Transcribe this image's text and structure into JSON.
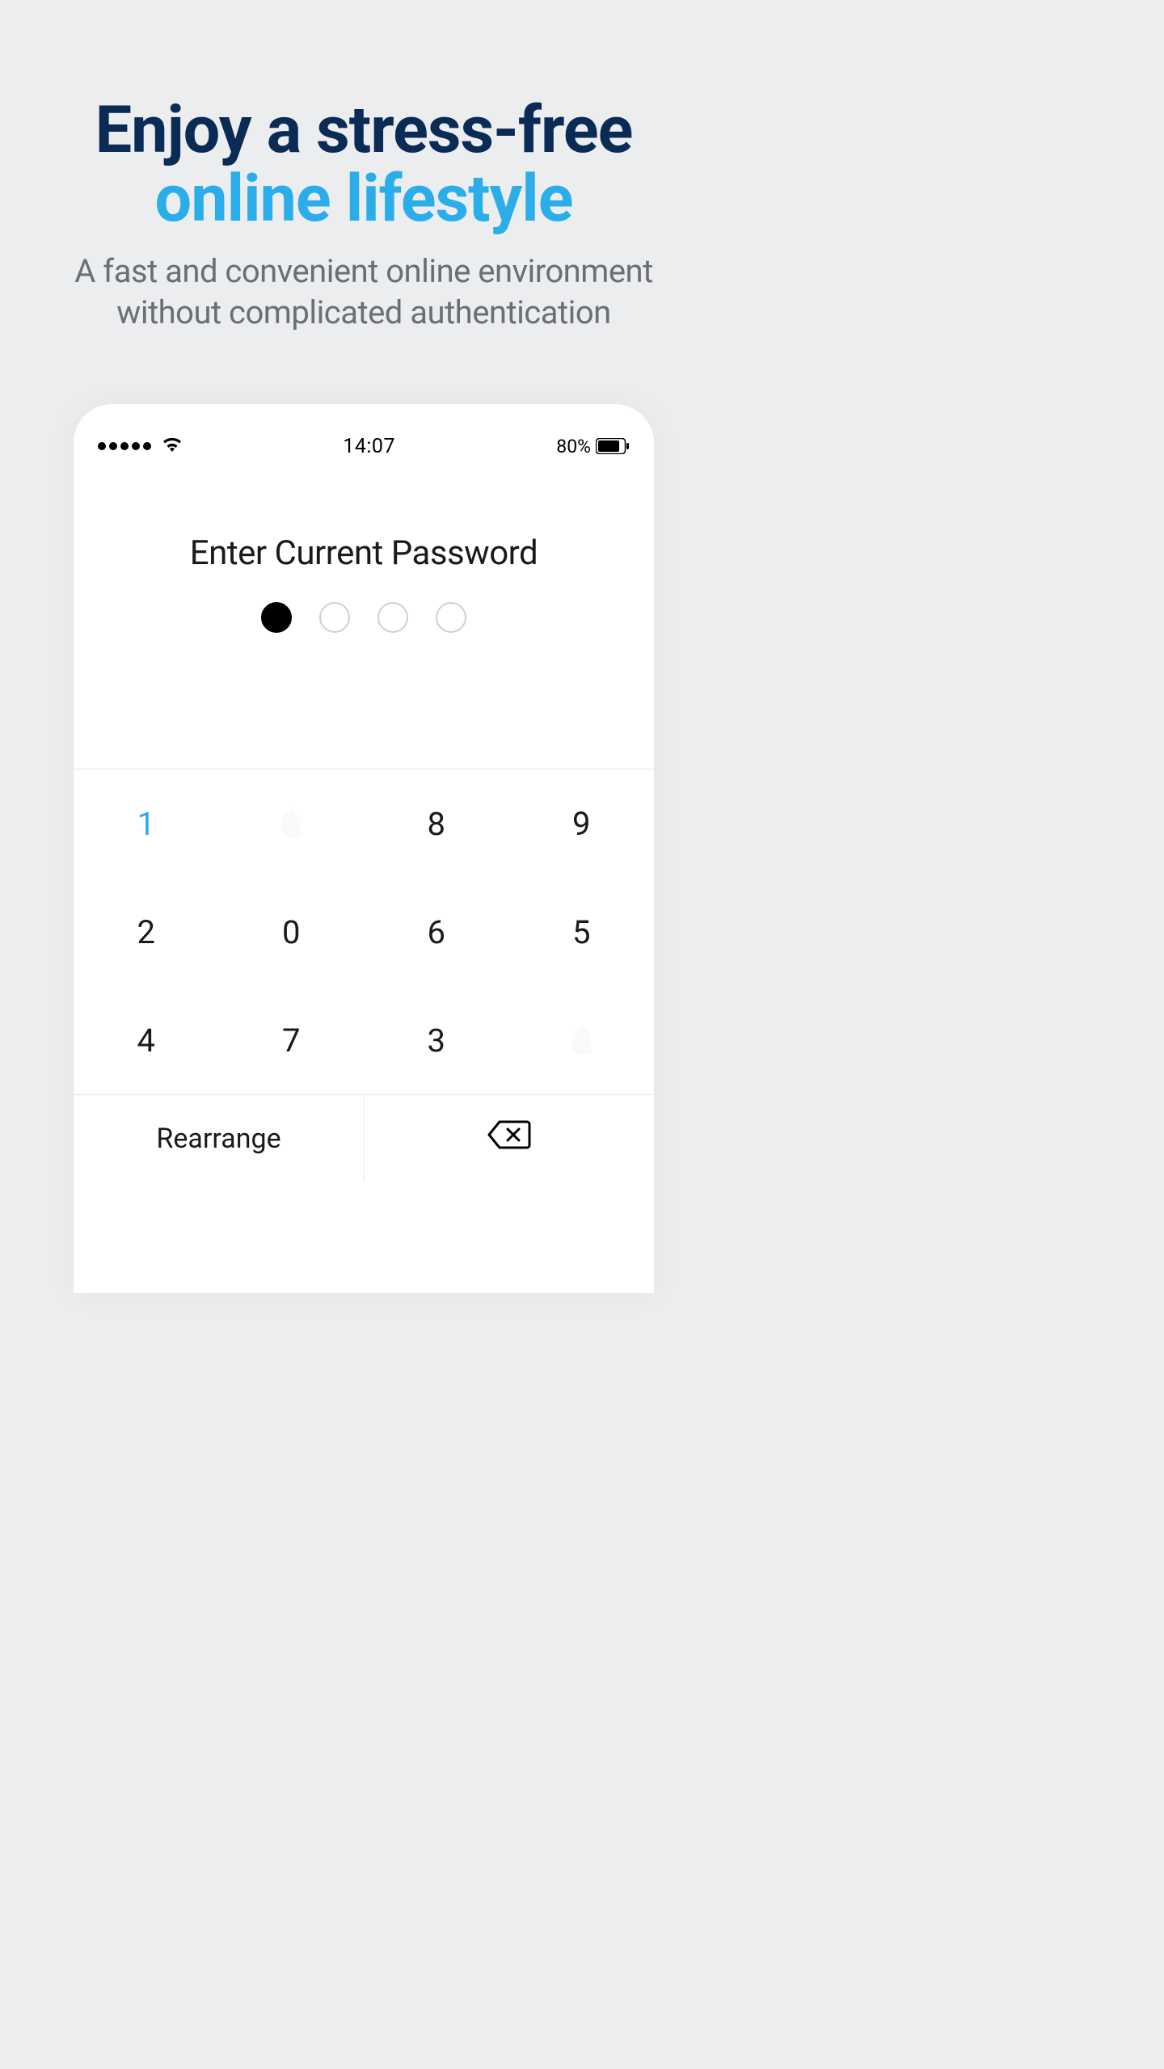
{
  "hero": {
    "title_line1": "Enjoy a stress-free",
    "title_line2": "online lifestyle",
    "subtitle_line1": "A fast and convenient online environment",
    "subtitle_line2": "without complicated authentication"
  },
  "status_bar": {
    "time": "14:07",
    "battery_percent": "80%"
  },
  "pin_screen": {
    "title": "Enter Current Password",
    "digits_total": 4,
    "digits_entered": 1
  },
  "keypad": {
    "rows": [
      [
        "1",
        "",
        "8",
        "9"
      ],
      [
        "2",
        "0",
        "6",
        "5"
      ],
      [
        "4",
        "7",
        "3",
        ""
      ]
    ],
    "active_key": "1"
  },
  "bottom": {
    "rearrange_label": "Rearrange"
  }
}
